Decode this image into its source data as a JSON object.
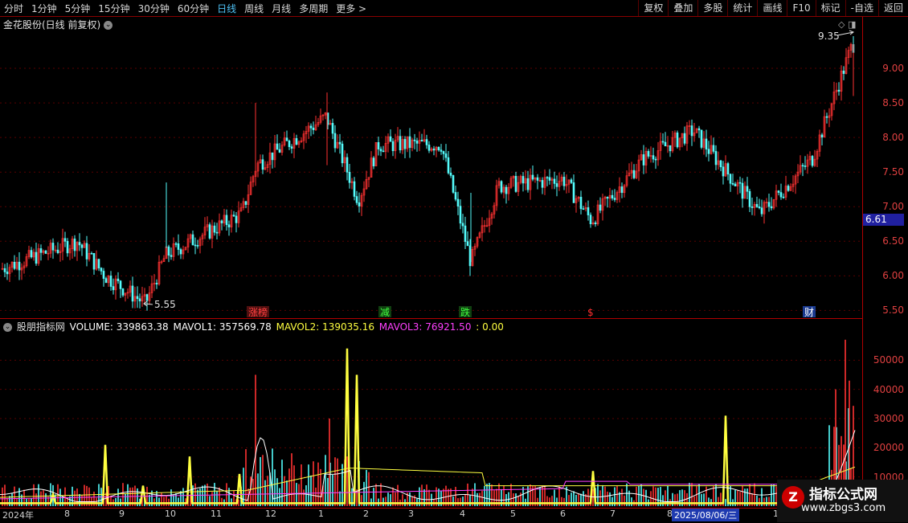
{
  "toolbar": {
    "periods": [
      "分时",
      "1分钟",
      "5分钟",
      "15分钟",
      "30分钟",
      "60分钟",
      "日线",
      "周线",
      "月线",
      "多周期",
      "更多 >"
    ],
    "active_period": "日线",
    "buttons": [
      "复权",
      "叠加",
      "多股",
      "统计",
      "画线",
      "F10",
      "标记",
      "-自选",
      "返回"
    ]
  },
  "main": {
    "title": "金花股份(日线 前复权)",
    "current_price": "6.61",
    "high_label": "9.35",
    "low_label": "5.55",
    "y_ticks": [
      "9.00",
      "8.50",
      "8.00",
      "7.50",
      "7.00",
      "6.50",
      "6.00",
      "5.50"
    ],
    "tags": [
      {
        "text": "涨榜",
        "color": "#ff4040",
        "bg": "#501010"
      },
      {
        "text": "减",
        "color": "#40ff40",
        "bg": "#104010"
      },
      {
        "text": "跌",
        "color": "#40ff40",
        "bg": "#104010"
      },
      {
        "text": "$",
        "color": "#ff3030",
        "bg": "transparent"
      },
      {
        "text": "财",
        "color": "#ffffff",
        "bg": "#1a3a90"
      }
    ]
  },
  "indicator": {
    "name": "股朋指标网",
    "volume": "VOLUME: 339863.38",
    "mavol1": "MAVOL1: 357569.78",
    "mavol2": "MAVOL2: 139035.16",
    "mavol3": "MAVOL3: 76921.50",
    "extra": ": 0.00",
    "y_ticks": [
      "50000",
      "40000",
      "30000",
      "20000",
      "10000"
    ],
    "colors": {
      "volume": "#ffffff",
      "mavol1": "#ffffff",
      "mavol2": "#ffff40",
      "mavol3": "#ff40ff",
      "extra": "#ffff40"
    }
  },
  "x_axis": {
    "start": "2024年",
    "months": [
      "8",
      "9",
      "10",
      "11",
      "12",
      "1",
      "2",
      "3",
      "4",
      "5",
      "6",
      "7",
      "8",
      "10"
    ],
    "highlight_date": "2025/08/06/三"
  },
  "watermark": {
    "title": "指标公式网",
    "url": "www.zbgs3.com",
    "logo": "Z"
  },
  "chart_data": {
    "type": "candlestick",
    "title": "金花股份(日线 前复权)",
    "y_range": [
      5.4,
      9.5
    ],
    "price_path": [
      {
        "x": "2024-07",
        "y": 6.1
      },
      {
        "x": "2024-08",
        "y": 6.5
      },
      {
        "x": "2024-09",
        "y": 6.0
      },
      {
        "x": "2024-10",
        "y": 5.6
      },
      {
        "x": "2024-10",
        "y": 6.3
      },
      {
        "x": "2024-11",
        "y": 6.9
      },
      {
        "x": "2024-12",
        "y": 7.6
      },
      {
        "x": "2025-01",
        "y": 8.3
      },
      {
        "x": "2025-02",
        "y": 7.1
      },
      {
        "x": "2025-02",
        "y": 7.9
      },
      {
        "x": "2025-04",
        "y": 7.9
      },
      {
        "x": "2025-04",
        "y": 6.2
      },
      {
        "x": "2025-05",
        "y": 7.3
      },
      {
        "x": "2025-06",
        "y": 7.4
      },
      {
        "x": "2025-07",
        "y": 6.8
      },
      {
        "x": "2025-08",
        "y": 7.7
      },
      {
        "x": "2025-09",
        "y": 8.1
      },
      {
        "x": "2025-10",
        "y": 6.9
      },
      {
        "x": "2025-11",
        "y": 7.7
      },
      {
        "x": "2025-12",
        "y": 9.35
      }
    ],
    "volume_range": [
      0,
      60000
    ],
    "volume_peaks": [
      54000,
      45000,
      31000,
      57000
    ]
  }
}
